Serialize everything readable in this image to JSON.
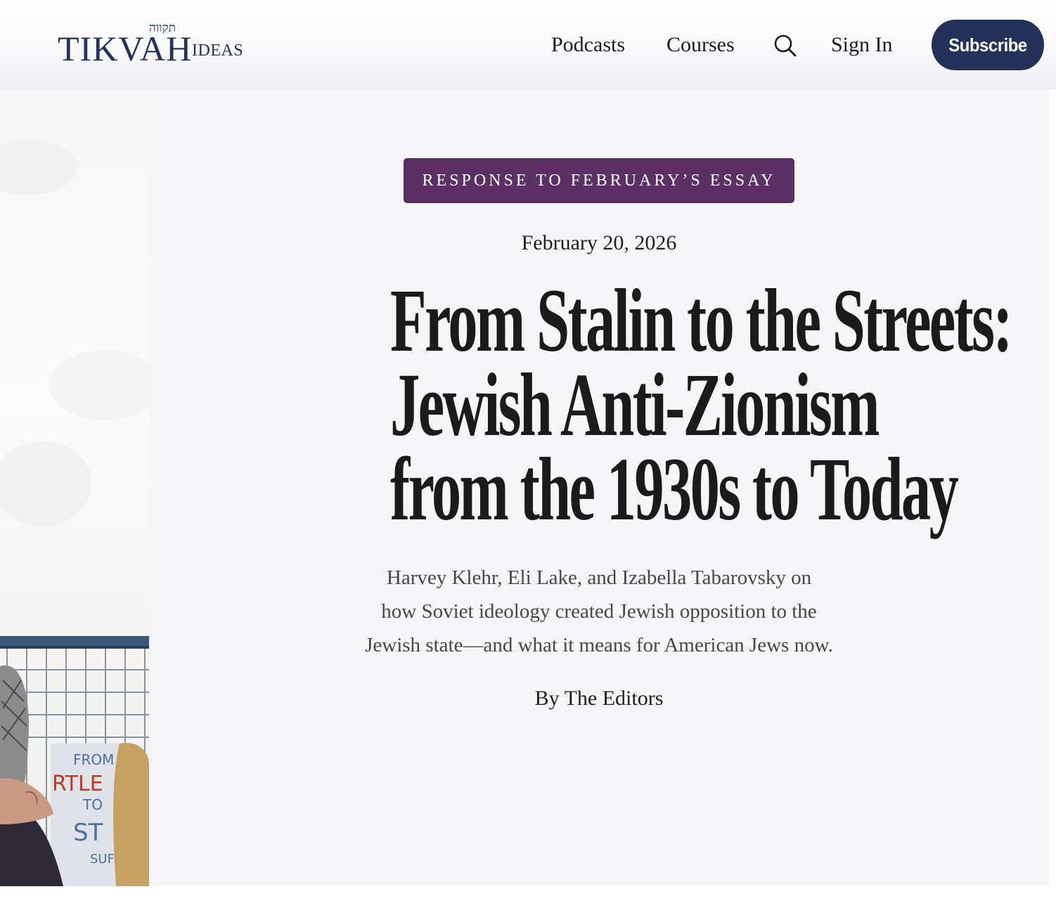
{
  "header": {
    "logo": {
      "wordmark": "TIKVAH",
      "sub": "IDEAS",
      "hebrew": "תקווה"
    },
    "nav": {
      "podcasts": "Podcasts",
      "courses": "Courses",
      "sign_in": "Sign In",
      "subscribe": "Subscribe"
    }
  },
  "icons": {
    "search": "search-icon"
  },
  "photo": {
    "sign_text": [
      "FROM",
      "RTLE",
      "TO",
      "ST",
      "SUF"
    ]
  },
  "article": {
    "tag": "RESPONSE TO FEBRUARY’S ESSAY",
    "date": "February 20, 2026",
    "headline": [
      "From Stalin to the Streets:",
      "Jewish Anti-Zionism",
      "from the 1930s to Today"
    ],
    "deck": [
      "Harvey Klehr, Eli Lake, and Izabella Tabarovsky on",
      "how Soviet ideology created Jewish opposition to the",
      "Jewish state—and what it means for American Jews now."
    ],
    "byline": "By The Editors"
  },
  "colors": {
    "brand_navy": "#24325a",
    "tag_purple": "#5b3165",
    "panel_bg": "#f6f5f8"
  }
}
